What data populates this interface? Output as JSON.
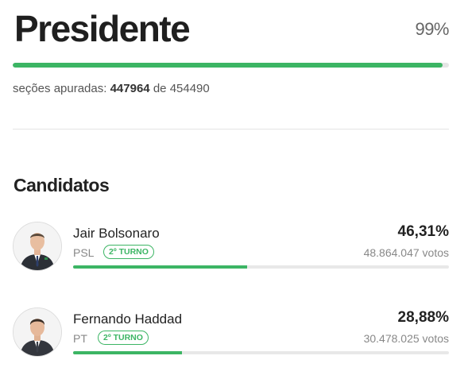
{
  "header": {
    "title": "Presidente",
    "percent_label": "99%",
    "progress_fraction": 0.986,
    "accent_color": "#3cb564"
  },
  "sections": {
    "prefix": "seções apuradas:",
    "counted": "447964",
    "middle": "de",
    "total": "454490"
  },
  "candidates_heading": "Candidatos",
  "candidates": [
    {
      "name": "Jair Bolsonaro",
      "party": "PSL",
      "badge": "2º TURNO",
      "percent": "46,31%",
      "votes": "48.864.047 votos",
      "share": 0.4631,
      "avatar_icon": "person-photo-icon"
    },
    {
      "name": "Fernando Haddad",
      "party": "PT",
      "badge": "2º TURNO",
      "percent": "28,88%",
      "votes": "30.478.025 votos",
      "share": 0.2888,
      "avatar_icon": "person-photo-icon"
    }
  ]
}
